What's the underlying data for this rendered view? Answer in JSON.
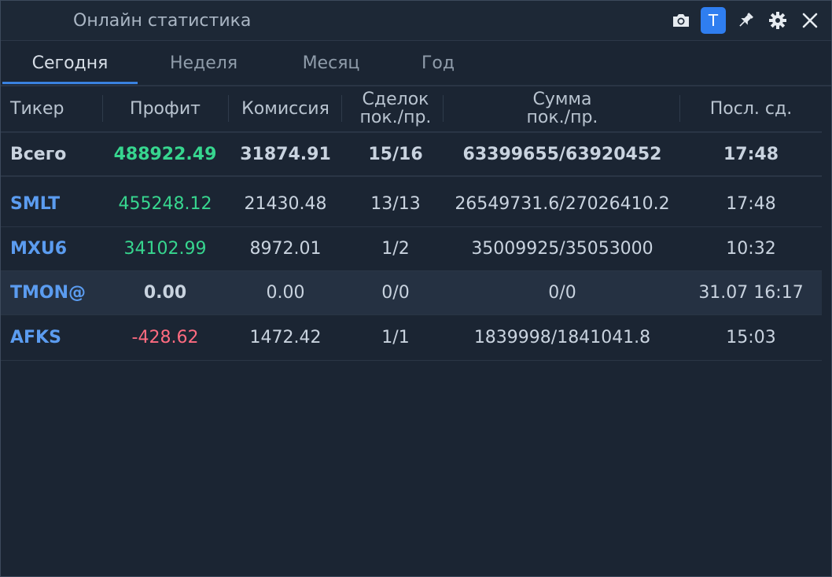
{
  "window": {
    "title": "Онлайн статистика",
    "t_badge": "T",
    "accent_color": "#2f7ef0"
  },
  "toolbar_icons": [
    "camera-icon",
    "t-badge",
    "pin-icon",
    "settings-icon",
    "close-icon"
  ],
  "tabs": [
    {
      "label": "Сегодня",
      "active": true
    },
    {
      "label": "Неделя",
      "active": false
    },
    {
      "label": "Месяц",
      "active": false
    },
    {
      "label": "Год",
      "active": false
    }
  ],
  "columns": {
    "ticker": "Тикер",
    "profit": "Профит",
    "commission": "Комиссия",
    "trades_l1": "Сделок",
    "trades_l2": "пок./пр.",
    "sum_l1": "Сумма",
    "sum_l2": "пок./пр.",
    "last": "Посл. сд."
  },
  "total": {
    "label": "Всего",
    "profit": "488922.49",
    "commission": "31874.91",
    "trades": "15/16",
    "sum": "63399655/63920452",
    "last": "17:48"
  },
  "rows": [
    {
      "ticker": "SMLT",
      "profit": "455248.12",
      "commission": "21430.48",
      "trades": "13/13",
      "sum": "26549731.6/27026410.2",
      "last": "17:48",
      "profit_sign": "pos"
    },
    {
      "ticker": "MXU6",
      "profit": "34102.99",
      "commission": "8972.01",
      "trades": "1/2",
      "sum": "35009925/35053000",
      "last": "10:32",
      "profit_sign": "pos"
    },
    {
      "ticker": "TMON@",
      "profit": "0.00",
      "commission": "0.00",
      "trades": "0/0",
      "sum": "0/0",
      "last": "31.07 16:17",
      "profit_sign": "zero"
    },
    {
      "ticker": "AFKS",
      "profit": "-428.62",
      "commission": "1472.42",
      "trades": "1/1",
      "sum": "1839998/1841041.8",
      "last": "15:03",
      "profit_sign": "neg"
    }
  ],
  "colors": {
    "positive": "#37d68f",
    "negative": "#ff6b80",
    "ticker": "#5b9cf0",
    "background": "#1b2533"
  }
}
